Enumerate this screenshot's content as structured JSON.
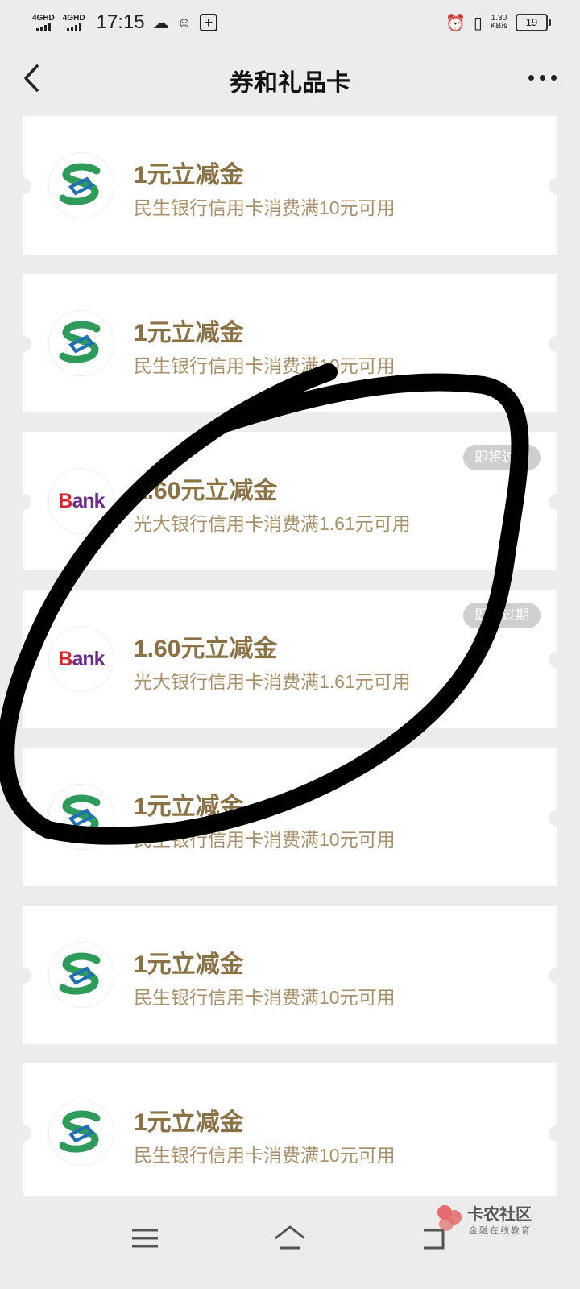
{
  "status_bar": {
    "signal1": "4GHD",
    "signal2": "4GHD",
    "time": "17:15",
    "net_speed": "1.30",
    "net_unit": "KB/s",
    "battery": "19"
  },
  "header": {
    "title": "券和礼品卡"
  },
  "coupons": [
    {
      "logo": "cmbc-logo",
      "title": "1元立减金",
      "desc": "民生银行信用卡消费满10元可用",
      "tag": ""
    },
    {
      "logo": "cmbc-logo",
      "title": "1元立减金",
      "desc": "民生银行信用卡消费满10元可用",
      "tag": ""
    },
    {
      "logo": "ceb-bank-logo",
      "title": "1.60元立减金",
      "desc": "光大银行信用卡消费满1.61元可用",
      "tag": "即将过期"
    },
    {
      "logo": "ceb-bank-logo",
      "title": "1.60元立减金",
      "desc": "光大银行信用卡消费满1.61元可用",
      "tag": "即将过期"
    },
    {
      "logo": "cmbc-logo",
      "title": "1元立减金",
      "desc": "民生银行信用卡消费满10元可用",
      "tag": ""
    },
    {
      "logo": "cmbc-logo",
      "title": "1元立减金",
      "desc": "民生银行信用卡消费满10元可用",
      "tag": ""
    },
    {
      "logo": "cmbc-logo",
      "title": "1元立减金",
      "desc": "民生银行信用卡消费满10元可用",
      "tag": ""
    }
  ],
  "bank_logo_text": {
    "b": "B",
    "rest": "ank"
  },
  "watermark": {
    "title": "卡农社区",
    "subtitle": "金融在线教育"
  },
  "colors": {
    "title": "#8b7245",
    "desc": "#a8916a",
    "background": "#ececec",
    "cmbc_green": "#2e9b5a",
    "cmbc_blue": "#1f6fb5"
  }
}
